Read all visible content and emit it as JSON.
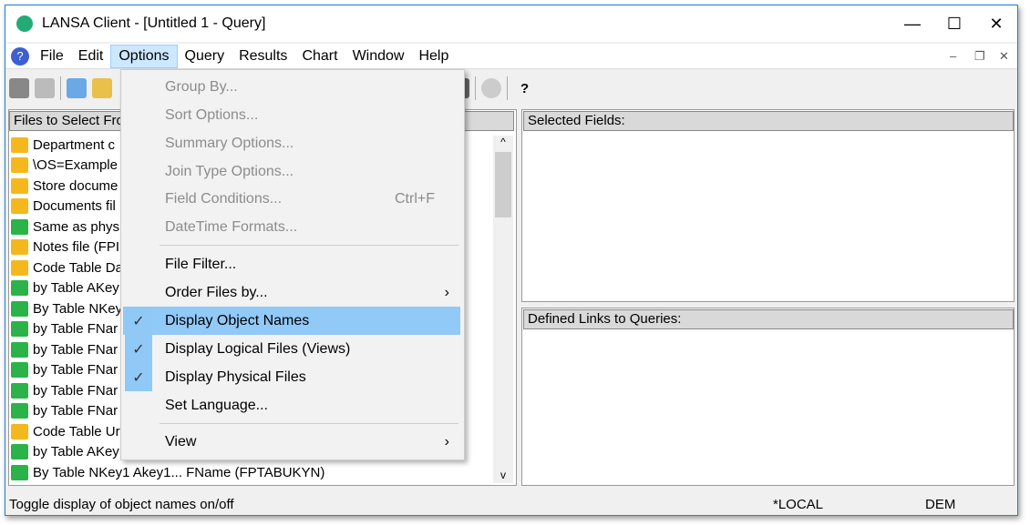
{
  "title": "LANSA Client - [Untitled 1 - Query]",
  "window_controls": {
    "minimize": "—",
    "maximize": "☐",
    "close": "✕"
  },
  "menubar": [
    "File",
    "Edit",
    "Options",
    "Query",
    "Results",
    "Chart",
    "Window",
    "Help"
  ],
  "mdi_controls": {
    "minimize": "–",
    "restore": "❐",
    "close": "✕"
  },
  "toolbar": {
    "help": "?"
  },
  "left_panel": {
    "header": "Files to Select From:",
    "items": [
      {
        "label": "Department c",
        "color": "orange"
      },
      {
        "label": "\\OS=Example",
        "color": "orange"
      },
      {
        "label": "Store docume",
        "color": "orange"
      },
      {
        "label": "Documents fil",
        "color": "orange"
      },
      {
        "label": "Same as phys",
        "color": "green"
      },
      {
        "label": "Notes file (FPI",
        "color": "orange"
      },
      {
        "label": "Code Table Da",
        "color": "orange"
      },
      {
        "label": "by Table AKey",
        "color": "green"
      },
      {
        "label": "By Table NKey",
        "color": "green"
      },
      {
        "label": "by Table FNar",
        "color": "green"
      },
      {
        "label": "by Table FNar",
        "color": "green"
      },
      {
        "label": "by Table FNar",
        "color": "green"
      },
      {
        "label": "by Table FNar",
        "color": "green"
      },
      {
        "label": "by Table FNar",
        "color": "green"
      },
      {
        "label": "Code Table Ur",
        "color": "orange"
      },
      {
        "label": "by Table AKey",
        "color": "green"
      },
      {
        "label": "By Table NKey1 Akey1... FName (FPTABUKYN)",
        "color": "green"
      }
    ]
  },
  "selected_fields": {
    "header": "Selected Fields:"
  },
  "defined_links": {
    "header": "Defined Links to Queries:"
  },
  "options_menu": [
    {
      "label": "Group By...",
      "disabled": true
    },
    {
      "label": "Sort Options...",
      "disabled": true
    },
    {
      "label": "Summary Options...",
      "disabled": true
    },
    {
      "label": "Join Type Options...",
      "disabled": true
    },
    {
      "label": "Field Conditions...",
      "shortcut": "Ctrl+F",
      "disabled": true
    },
    {
      "label": "DateTime Formats...",
      "disabled": true
    },
    {
      "label": "File Filter..."
    },
    {
      "label": "Order Files by...",
      "submenu": "›"
    },
    {
      "label": "Display Object Names",
      "checked": "✓"
    },
    {
      "label": "Display Logical Files (Views)",
      "checked": "✓"
    },
    {
      "label": "Display Physical Files",
      "checked": "✓"
    },
    {
      "label": "Set Language..."
    },
    {
      "label": "View",
      "submenu": "›"
    }
  ],
  "status": {
    "message": "Toggle display of object names on/off",
    "location": "*LOCAL",
    "partition": "DEM"
  },
  "colors": {
    "orange": "#f5b81c",
    "green": "#2bb34a",
    "highlight": "#91c9f7"
  }
}
